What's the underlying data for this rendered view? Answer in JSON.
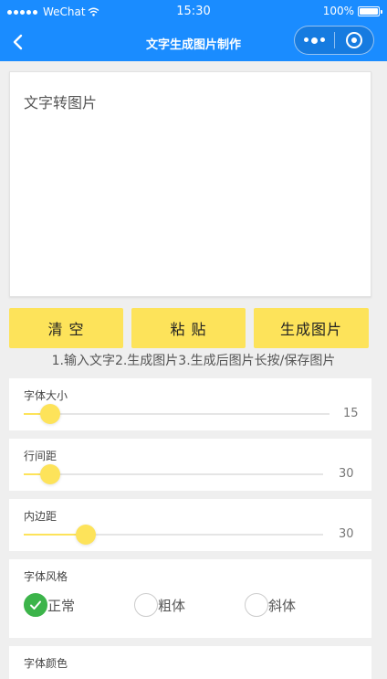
{
  "status_bar": {
    "carrier": "WeChat",
    "time": "15:30",
    "battery": "100%",
    "battery_level": 1.0
  },
  "navbar": {
    "title": "文字生成图片制作",
    "back_icon": "chevron-left-icon",
    "more_icon": "more-dots-icon",
    "close_icon": "target-circle-icon"
  },
  "editor": {
    "placeholder": "文字转图片"
  },
  "buttons": {
    "clear": "清 空",
    "paste": "粘 贴",
    "generate": "生成图片"
  },
  "instructions": "1.输入文字2.生成图片3.生成后图片长按/保存图片",
  "settings": {
    "font_size": {
      "label": "字体大小",
      "value": "15",
      "fraction": 0.06
    },
    "line_spacing": {
      "label": "行间距",
      "value": "30",
      "fraction": 0.06
    },
    "padding": {
      "label": "内边距",
      "value": "30",
      "fraction": 0.18
    },
    "font_style": {
      "label": "字体风格",
      "options": [
        "正常",
        "粗体",
        "斜体"
      ],
      "selected": "正常"
    },
    "font_color": {
      "label": "字体颜色"
    }
  },
  "colors": {
    "primary": "#1a8cff",
    "accent": "#fde35a",
    "checked": "#3cb44a",
    "background": "#efefef"
  }
}
